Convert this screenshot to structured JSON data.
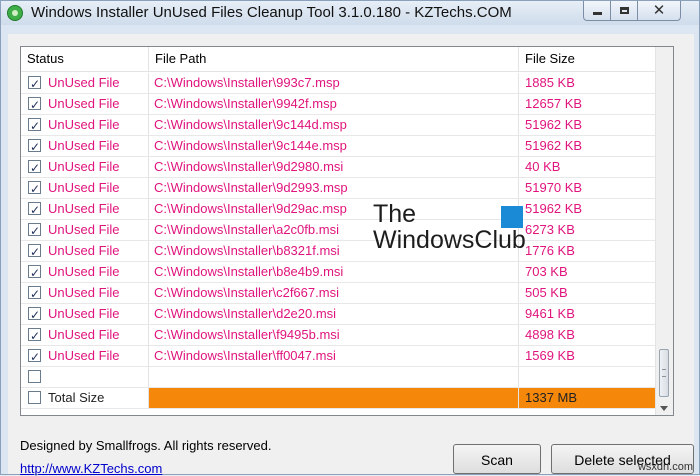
{
  "window": {
    "title": "Windows Installer UnUsed Files Cleanup Tool 3.1.0.180 - KZTechs.COM"
  },
  "columns": {
    "status": "Status",
    "path": "File Path",
    "size": "File Size"
  },
  "rows": [
    {
      "status": "UnUsed File",
      "path": "C:\\Windows\\Installer\\993c7.msp",
      "size": "1885 KB",
      "checked": true
    },
    {
      "status": "UnUsed File",
      "path": "C:\\Windows\\Installer\\9942f.msp",
      "size": "12657 KB",
      "checked": true
    },
    {
      "status": "UnUsed File",
      "path": "C:\\Windows\\Installer\\9c144d.msp",
      "size": "51962 KB",
      "checked": true
    },
    {
      "status": "UnUsed File",
      "path": "C:\\Windows\\Installer\\9c144e.msp",
      "size": "51962 KB",
      "checked": true
    },
    {
      "status": "UnUsed File",
      "path": "C:\\Windows\\Installer\\9d2980.msi",
      "size": "40 KB",
      "checked": true
    },
    {
      "status": "UnUsed File",
      "path": "C:\\Windows\\Installer\\9d2993.msp",
      "size": "51970 KB",
      "checked": true
    },
    {
      "status": "UnUsed File",
      "path": "C:\\Windows\\Installer\\9d29ac.msp",
      "size": "51962 KB",
      "checked": true
    },
    {
      "status": "UnUsed File",
      "path": "C:\\Windows\\Installer\\a2c0fb.msi",
      "size": "6273 KB",
      "checked": true
    },
    {
      "status": "UnUsed File",
      "path": "C:\\Windows\\Installer\\b8321f.msi",
      "size": "1776 KB",
      "checked": true
    },
    {
      "status": "UnUsed File",
      "path": "C:\\Windows\\Installer\\b8e4b9.msi",
      "size": "703 KB",
      "checked": true
    },
    {
      "status": "UnUsed File",
      "path": "C:\\Windows\\Installer\\c2f667.msi",
      "size": "505 KB",
      "checked": true
    },
    {
      "status": "UnUsed File",
      "path": "C:\\Windows\\Installer\\d2e20.msi",
      "size": "9461 KB",
      "checked": true
    },
    {
      "status": "UnUsed File",
      "path": "C:\\Windows\\Installer\\f9495b.msi",
      "size": "4898 KB",
      "checked": true
    },
    {
      "status": "UnUsed File",
      "path": "C:\\Windows\\Installer\\ff0047.msi",
      "size": "1569 KB",
      "checked": true
    }
  ],
  "empty_row": {
    "status": "",
    "path": "",
    "size": "",
    "checked": false
  },
  "total_row": {
    "label": "Total Size",
    "size": "1337 MB",
    "checked": false,
    "highlight_color": "#f5880a"
  },
  "watermark": {
    "line1": "The",
    "line2": "WindowsClub"
  },
  "footer": {
    "credit": "Designed by Smallfrogs. All rights reserved.",
    "link": "http://www.KZTechs.com"
  },
  "buttons": {
    "scan": "Scan",
    "delete_selected": "Delete selected"
  },
  "site_mark": "wsxdn.com",
  "colors": {
    "unused_text": "#e0147d",
    "accent_total": "#f5880a"
  }
}
